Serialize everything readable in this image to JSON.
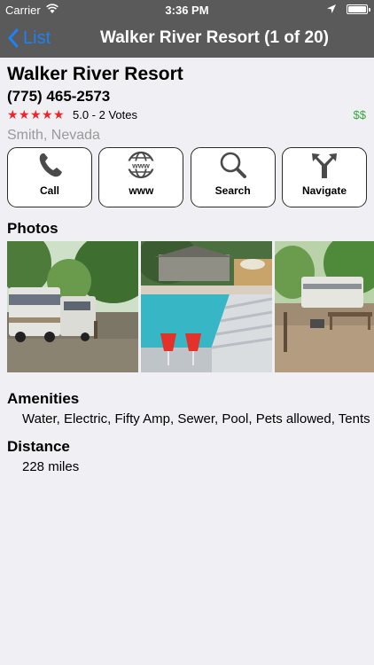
{
  "status_bar": {
    "carrier": "Carrier",
    "time": "3:36 PM"
  },
  "nav": {
    "back_label": "List",
    "title": "Walker River Resort (1 of 20)"
  },
  "listing": {
    "name": "Walker River Resort",
    "phone": "(775) 465-2573",
    "rating_text": "5.0 - 2 Votes",
    "stars": 5,
    "price": "$$",
    "location": "Smith, Nevada"
  },
  "actions": [
    {
      "label": "Call",
      "icon": "phone-icon"
    },
    {
      "label": "www",
      "icon": "globe-icon"
    },
    {
      "label": "Search",
      "icon": "magnifier-icon"
    },
    {
      "label": "Navigate",
      "icon": "fork-arrow-icon"
    }
  ],
  "photos_section": {
    "title": "Photos"
  },
  "amenities": {
    "title": "Amenities",
    "text": "Water, Electric, Fifty Amp, Sewer, Pool, Pets allowed, Tents"
  },
  "distance": {
    "title": "Distance",
    "text": "228 miles"
  },
  "colors": {
    "nav_bg": "#5a5a5a",
    "accent": "#1a82fb",
    "star": "#e8262b",
    "price": "#3aa83a",
    "page_bg": "#efeff4"
  }
}
